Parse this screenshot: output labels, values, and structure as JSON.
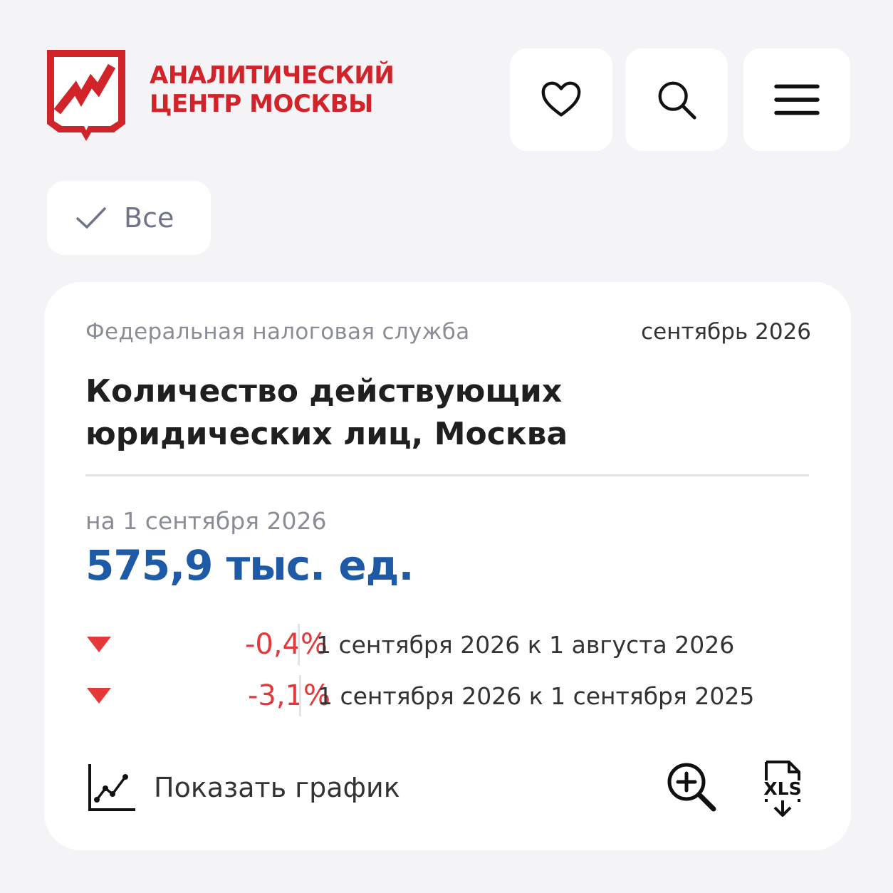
{
  "brand": {
    "line1": "АНАЛИТИЧЕСКИЙ",
    "line2": "ЦЕНТР МОСКВЫ",
    "color": "#d1232a"
  },
  "header_icons": [
    "heart-icon",
    "search-icon",
    "menu-icon"
  ],
  "filter": {
    "label": "Все",
    "icon": "check-icon"
  },
  "card": {
    "source": "Федеральная налоговая служба",
    "period": "сентябрь 2026",
    "title": "Количество действующих юридических лиц, Москва",
    "date_label": "на 1 сентября 2026",
    "value": "575,9 тыс. ед.",
    "value_color": "#1e5aa6",
    "changes": [
      {
        "percent": "-0,4%",
        "description": "1 сентября 2026 к 1 августа 2026",
        "direction": "down"
      },
      {
        "percent": "-3,1%",
        "description": "1 сентября 2026 к 1 сентября 2025",
        "direction": "down"
      }
    ],
    "negative_color": "#e5383b",
    "show_chart_label": "Показать график",
    "actions": [
      "zoom-in-icon",
      "xls-download-icon"
    ]
  }
}
